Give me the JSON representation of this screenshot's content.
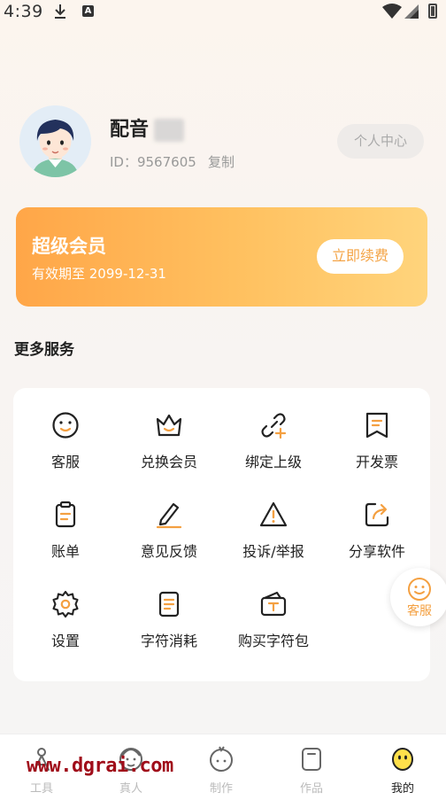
{
  "status_bar": {
    "time": "4:39"
  },
  "profile": {
    "name": "配音",
    "id_text": "ID：9567605",
    "copy_label": "复制",
    "center_button": "个人中心"
  },
  "vip": {
    "title": "超级会员",
    "expiry": "有效期至 2099-12-31",
    "renew_button": "立即续费"
  },
  "services": {
    "section_title": "更多服务",
    "items": [
      {
        "label": "客服",
        "icon": "smile-icon"
      },
      {
        "label": "兑换会员",
        "icon": "crown-icon"
      },
      {
        "label": "绑定上级",
        "icon": "link-plus-icon"
      },
      {
        "label": "开发票",
        "icon": "invoice-icon"
      },
      {
        "label": "账单",
        "icon": "clipboard-icon"
      },
      {
        "label": "意见反馈",
        "icon": "pencil-icon"
      },
      {
        "label": "投诉/举报",
        "icon": "warning-icon"
      },
      {
        "label": "分享软件",
        "icon": "share-icon"
      },
      {
        "label": "设置",
        "icon": "gear-icon"
      },
      {
        "label": "字符消耗",
        "icon": "document-icon"
      },
      {
        "label": "购买字符包",
        "icon": "wallet-icon"
      }
    ]
  },
  "floating_service": {
    "label": "客服"
  },
  "bottom_nav": {
    "items": [
      {
        "label": "工具",
        "icon": "tools-icon"
      },
      {
        "label": "真人",
        "icon": "person-face-icon"
      },
      {
        "label": "制作",
        "icon": "create-icon"
      },
      {
        "label": "作品",
        "icon": "works-icon"
      },
      {
        "label": "我的",
        "icon": "mine-icon"
      }
    ],
    "active_index": 4
  },
  "watermark": "www.dgrai.com",
  "colors": {
    "accent": "#f4a041",
    "vip_gradient_start": "#ffa648",
    "vip_gradient_end": "#ffd47c",
    "watermark": "#a00d1a"
  }
}
